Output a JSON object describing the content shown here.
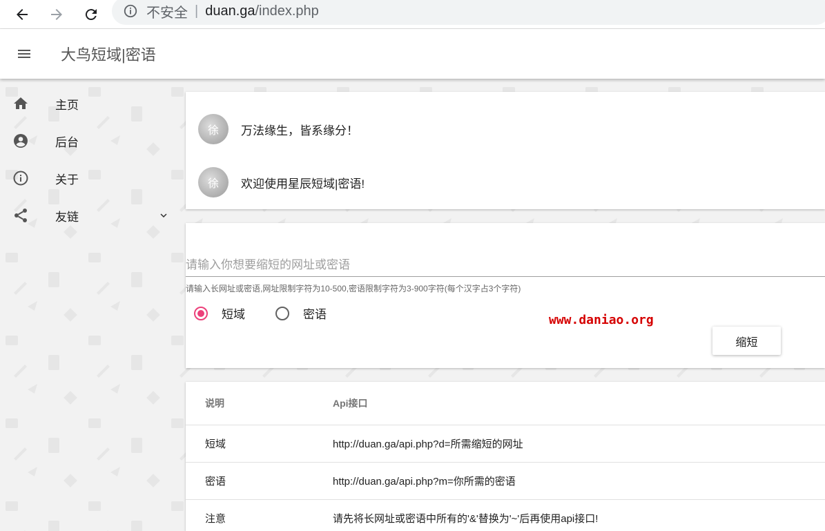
{
  "browser": {
    "insecure_label": "不安全",
    "url_host": "duan.ga",
    "url_path": "/index.php"
  },
  "header": {
    "title": "大鸟短域|密语"
  },
  "sidebar": {
    "items": [
      {
        "label": "主页",
        "icon": "home-icon"
      },
      {
        "label": "后台",
        "icon": "account-circle-icon"
      },
      {
        "label": "关于",
        "icon": "info-icon"
      },
      {
        "label": "友链",
        "icon": "share-icon"
      }
    ]
  },
  "messages": [
    {
      "avatar_text": "徐",
      "text": "万法缘生，皆系缘分！"
    },
    {
      "avatar_text": "徐",
      "text": "欢迎使用星辰短域|密语!"
    }
  ],
  "form": {
    "input_placeholder": "请输入你想要缩短的网址或密语",
    "input_value": "",
    "hint": "请输入长网址或密语,网址限制字符为10-500,密语限制字符为3-900字符(每个汉字占3个字符)",
    "radio_short": "短域",
    "radio_secret": "密语",
    "selected": "短域",
    "submit_label": "缩短",
    "accent_color": "#ec407a"
  },
  "watermark": "www.daniao.org",
  "table": {
    "headers": [
      "说明",
      "Api接口"
    ],
    "rows": [
      [
        "短域",
        "http://duan.ga/api.php?d=所需缩短的网址"
      ],
      [
        "密语",
        "http://duan.ga/api.php?m=你所需的密语"
      ],
      [
        "注意",
        "请先将长网址或密语中所有的'&'替换为'~'后再使用api接口!"
      ]
    ]
  }
}
